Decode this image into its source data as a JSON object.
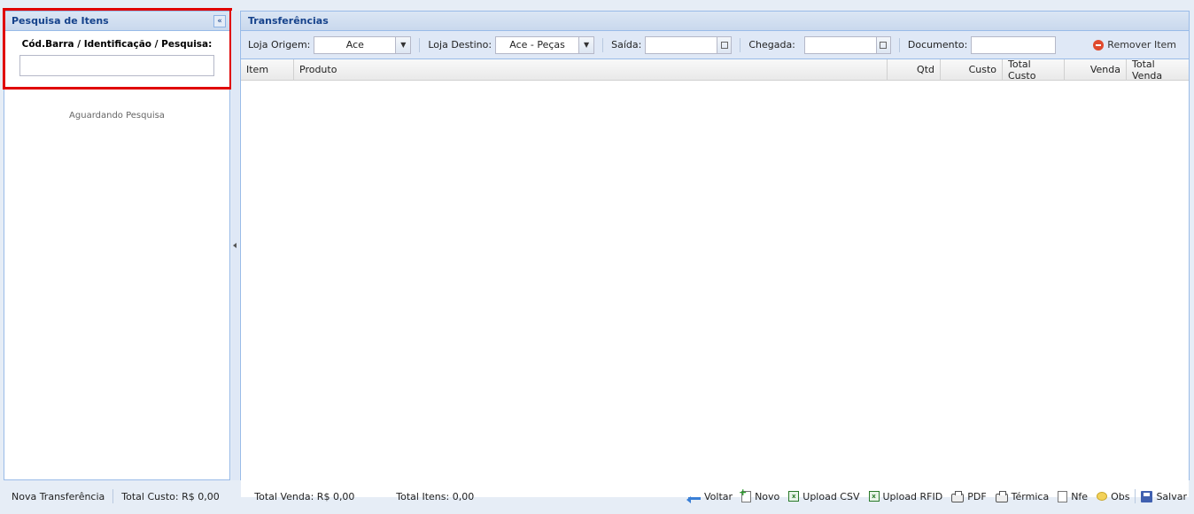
{
  "left_panel": {
    "title": "Pesquisa de Itens",
    "collapse_glyph": "«",
    "search_label": "Cód.Barra / Identificação / Pesquisa:",
    "search_value": "",
    "waiting_text": "Aguardando Pesquisa"
  },
  "right_panel": {
    "title": "Transferências",
    "toolbar": {
      "origin_label": "Loja Origem:",
      "origin_value": "Ace",
      "dest_label": "Loja Destino:",
      "dest_value": "Ace - Peças",
      "saida_label": "Saída:",
      "chegada_label": "Chegada:",
      "documento_label": "Documento:",
      "remove_label": "Remover Item"
    },
    "columns": [
      "Item",
      "Produto",
      "Qtd",
      "Custo",
      "Total Custo",
      "Venda",
      "Total Venda"
    ]
  },
  "statusbar": {
    "new_transfer": "Nova Transferência",
    "total_custo": "Total Custo: R$ 0,00",
    "total_venda": "Total Venda: R$ 0,00",
    "total_itens": "Total Itens: 0,00",
    "actions": {
      "voltar": "Voltar",
      "novo": "Novo",
      "upload_csv": "Upload CSV",
      "upload_rfid": "Upload RFID",
      "pdf": "PDF",
      "termica": "Térmica",
      "nfe": "Nfe",
      "obs": "Obs",
      "salvar": "Salvar"
    }
  },
  "colors": {
    "header_text": "#15428b",
    "border": "#99bbe8",
    "highlight": "#e00000"
  }
}
